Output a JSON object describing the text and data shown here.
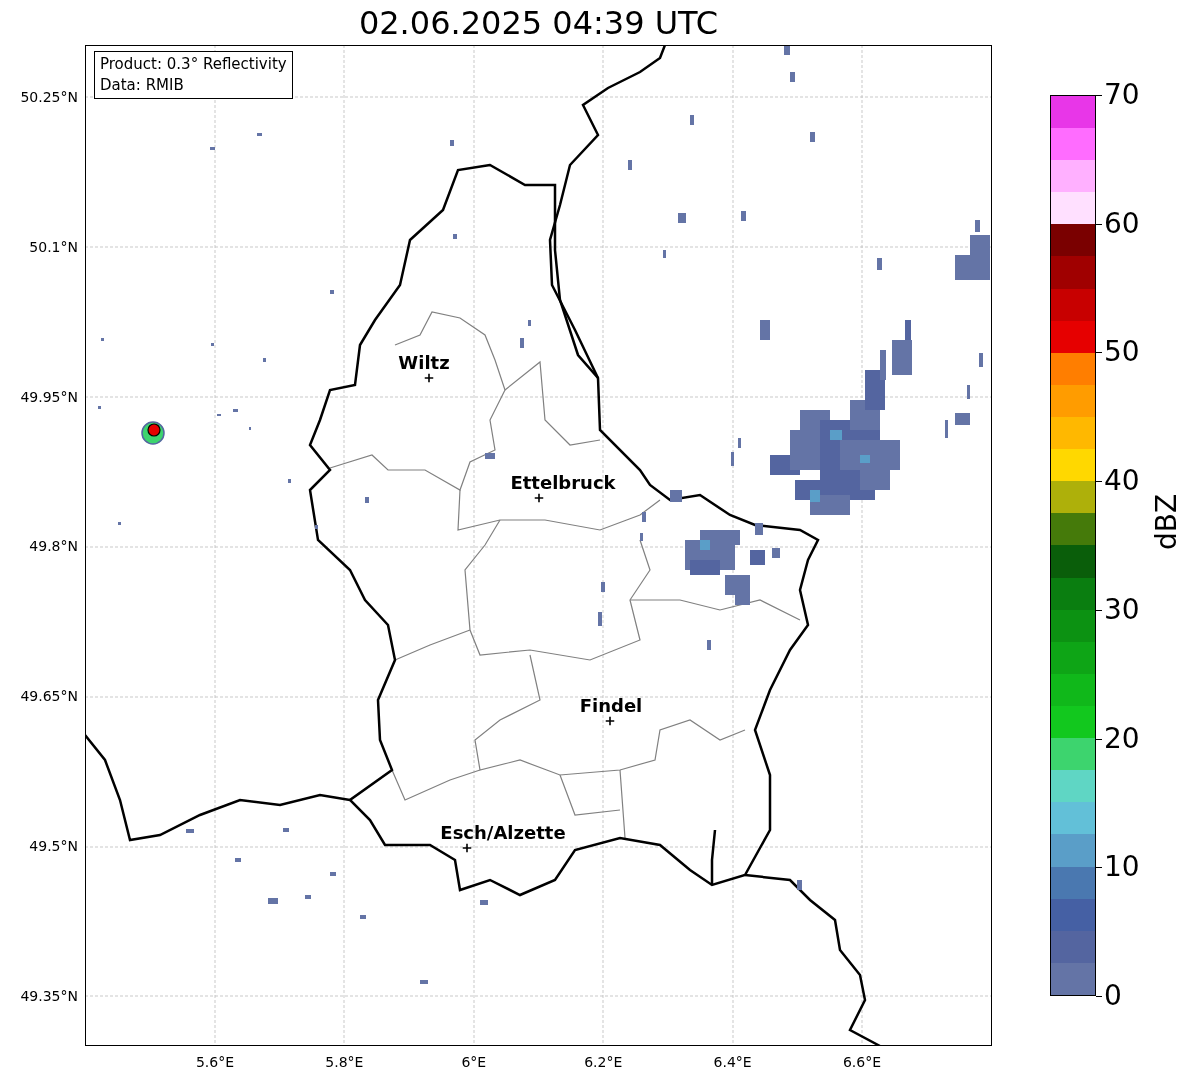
{
  "title": "02.06.2025 04:39 UTC",
  "info_box": {
    "product": "Product: 0.3° Reflectivity",
    "data": "Data: RMIB"
  },
  "lat_ticks": [
    "50.25°N",
    "50.1°N",
    "49.95°N",
    "49.8°N",
    "49.65°N",
    "49.5°N",
    "49.35°N"
  ],
  "lon_ticks": [
    "5.6°E",
    "5.8°E",
    "6°E",
    "6.2°E",
    "6.4°E",
    "6.6°E"
  ],
  "places": [
    {
      "name": "Wiltz"
    },
    {
      "name": "Ettelbruck"
    },
    {
      "name": "Findel"
    },
    {
      "name": "Esch/Alzette"
    }
  ],
  "colorbar": {
    "label": "dBZ",
    "ticks": [
      "70",
      "60",
      "50",
      "40",
      "30",
      "20",
      "10",
      "0"
    ]
  }
}
